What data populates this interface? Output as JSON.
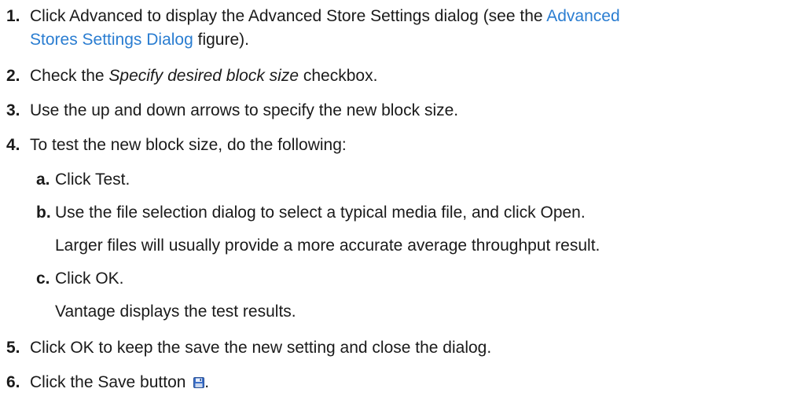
{
  "steps": [
    {
      "num": "1.",
      "text_before": "Click Advanced to display the Advanced Store Settings dialog (see the ",
      "link_part1": "Advanced",
      "link_part2": "Stores Settings Dialog",
      "text_after": " figure)."
    },
    {
      "num": "2.",
      "text_before": "Check the ",
      "emphasis": "Specify desired block size",
      "text_after": " checkbox."
    },
    {
      "num": "3.",
      "text": "Use the up and down arrows to specify the new block size."
    },
    {
      "num": "4.",
      "text": "To test the new block size, do the following:",
      "substeps": [
        {
          "num": "a.",
          "text": "Click Test."
        },
        {
          "num": "b.",
          "text": "Use the file selection dialog to select a typical media file, and click Open.",
          "note": "Larger files will usually provide a more accurate average throughput result."
        },
        {
          "num": "c.",
          "text": "Click OK.",
          "note": "Vantage displays the test results."
        }
      ]
    },
    {
      "num": "5.",
      "text": "Click OK to keep the save the new setting and close the dialog."
    },
    {
      "num": "6.",
      "text_before": "Click the Save button ",
      "icon": "save-icon",
      "text_after": "."
    }
  ]
}
